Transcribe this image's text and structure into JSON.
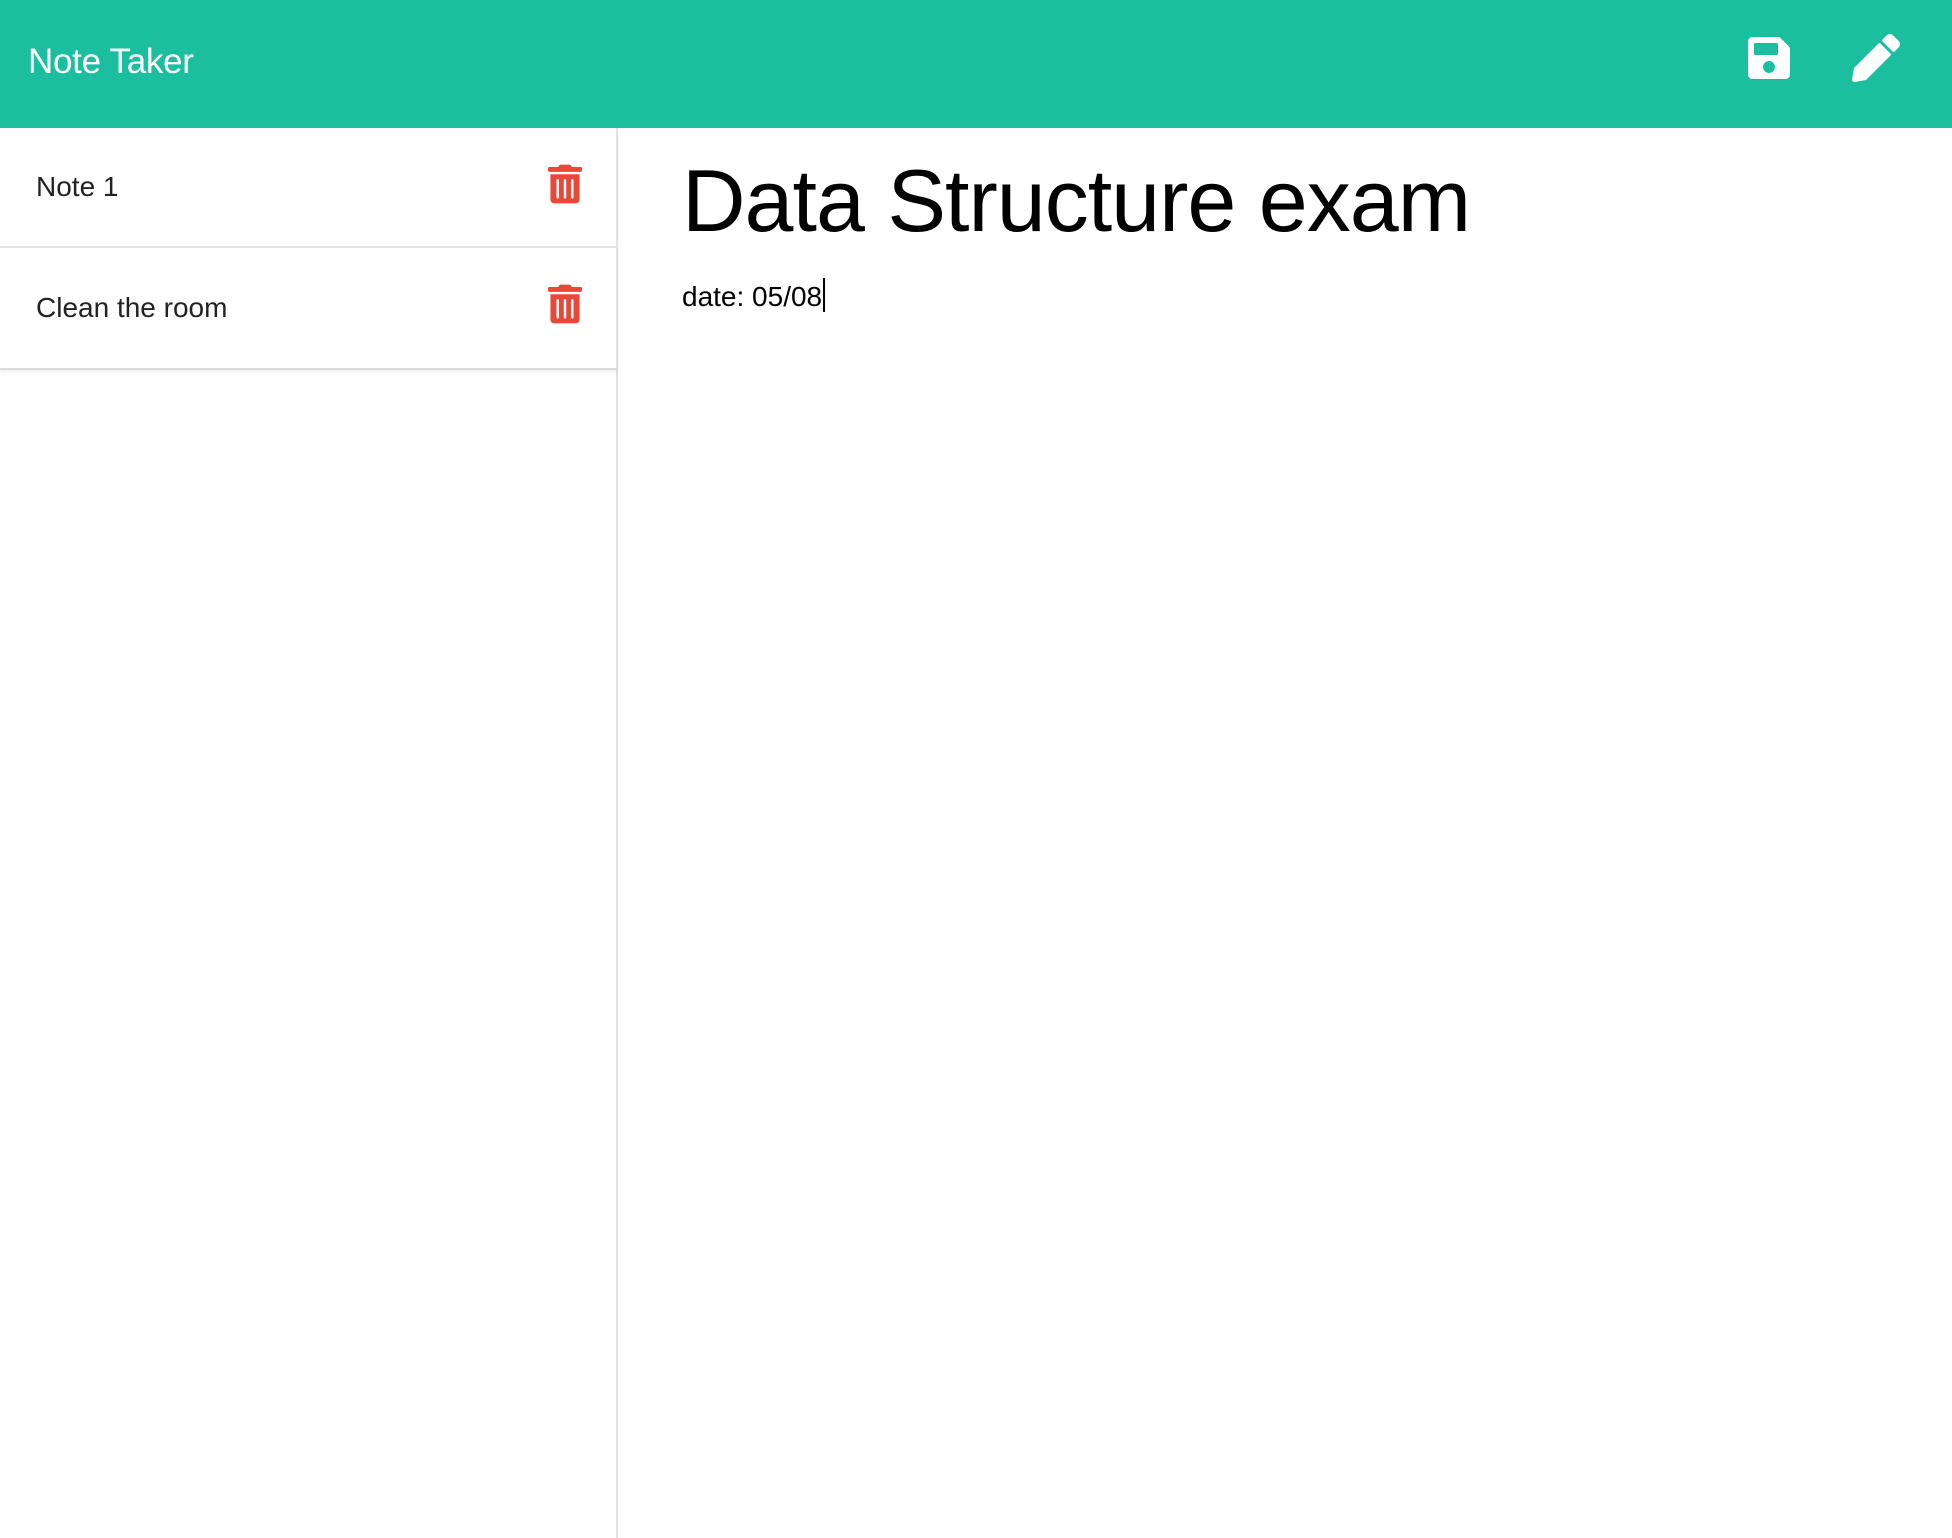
{
  "app": {
    "title": "Note Taker",
    "accent_color": "#1bbe9e",
    "delete_color": "#e8483a"
  },
  "toolbar": {
    "save_icon": "save-icon",
    "new_note_icon": "pencil-icon"
  },
  "notes": [
    {
      "title": "Note 1"
    },
    {
      "title": "Clean the room"
    }
  ],
  "editor": {
    "title": "Data Structure exam",
    "text": "date: 05/08"
  }
}
